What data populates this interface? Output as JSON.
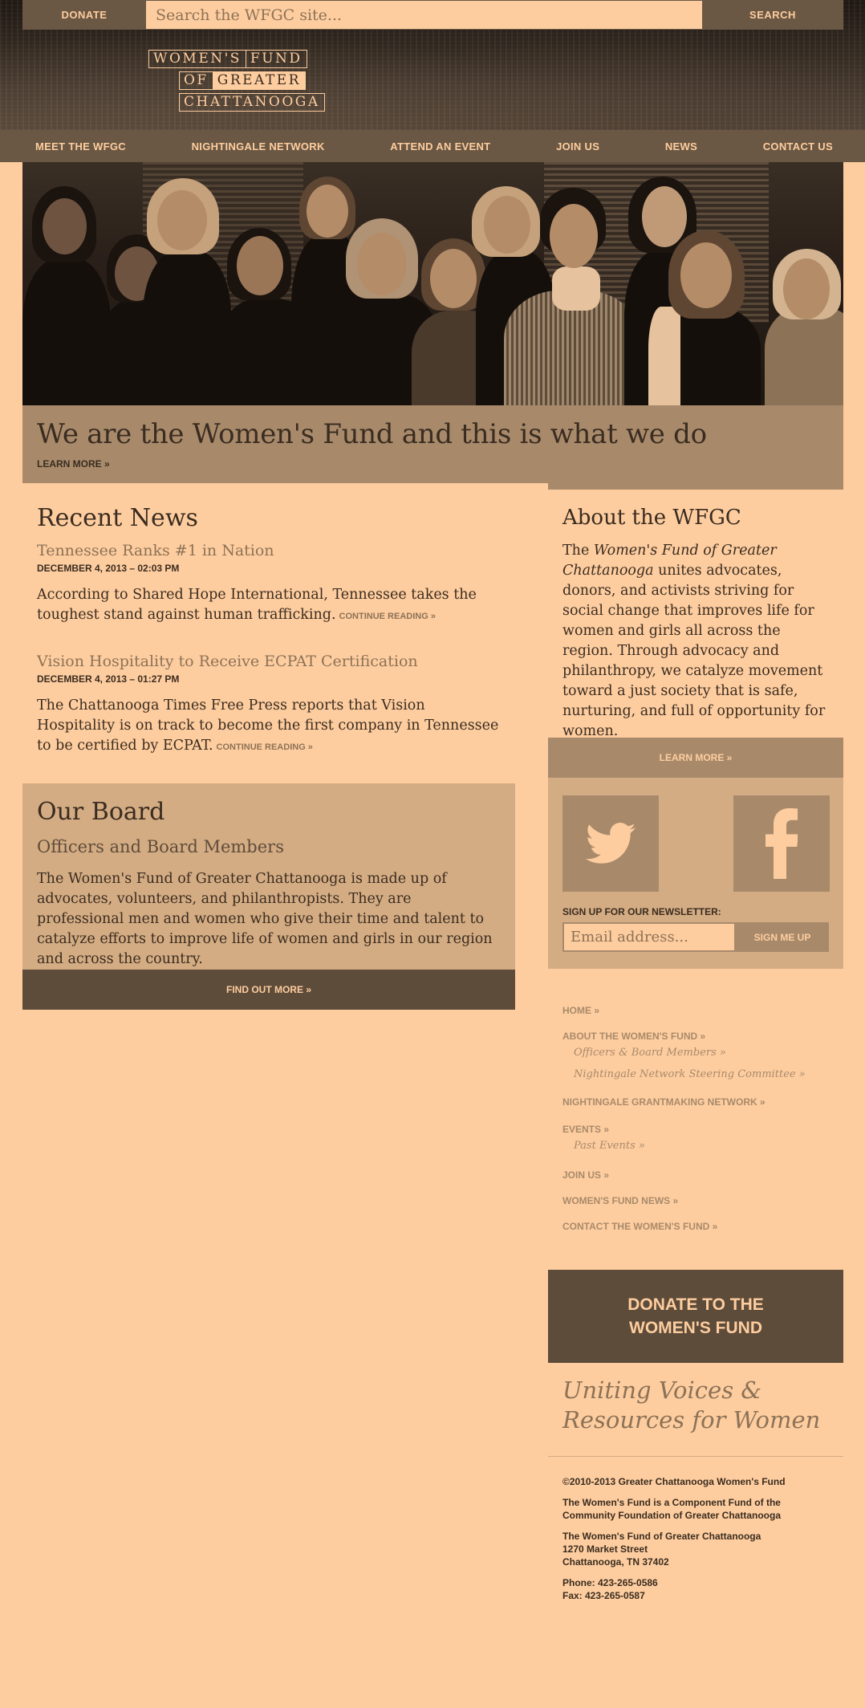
{
  "topbar": {
    "donate_label": "DONATE",
    "search_placeholder": "Search the WFGC site...",
    "search_label": "SEARCH"
  },
  "logo": {
    "line1a": "WOMEN'S",
    "line1b": "FUND",
    "line2a": "OF",
    "line2b": "GREATER",
    "line3": "CHATTANOOGA"
  },
  "nav": {
    "items": [
      "MEET THE WFGC",
      "NIGHTINGALE NETWORK",
      "ATTEND AN EVENT",
      "JOIN US",
      "NEWS",
      "CONTACT US"
    ]
  },
  "hero": {
    "headline": "We are the Women's Fund and this is what we do",
    "learn_more": "LEARN MORE  »"
  },
  "news": {
    "heading": "Recent News",
    "items": [
      {
        "title": "Tennessee Ranks #1 in Nation",
        "date": "DECEMBER 4, 2013 – 02:03 PM",
        "body": "According to Shared Hope International, Tennessee takes the toughest stand against human trafficking.",
        "continue": "CONTINUE READING »"
      },
      {
        "title": "Vision Hospitality to Receive ECPAT Certification",
        "date": "DECEMBER 4, 2013 – 01:27 PM",
        "body": "The Chattanooga Times Free Press reports that Vision Hospitality is on track to become the first company in Tennessee to be certified by ECPAT.",
        "continue": "CONTINUE READING »"
      }
    ]
  },
  "board": {
    "heading": "Our Board",
    "subheading": "Officers and Board Members",
    "body": "The Women's Fund of Greater Chattanooga is made up of advocates, volunteers, and philanthropists. They are professional men and women who give their time and talent to catalyze efforts to improve life of women and girls in our region and across the country.",
    "button": "FIND OUT MORE »"
  },
  "about": {
    "heading": "About the WFGC",
    "body_prefix": "The ",
    "body_em": "Women's Fund of Greater Chattanooga",
    "body_rest": " unites advocates, donors, and activists striving for social change that improves life for women and girls all across the region. Through advocacy and philanthropy, we catalyze movement toward a just society that is safe, nurturing, and full of opportunity for women.",
    "button": "LEARN MORE »"
  },
  "newsletter": {
    "label": "SIGN UP FOR OUR NEWSLETTER:",
    "placeholder": "Email address...",
    "button": "SIGN ME UP"
  },
  "sitemap": {
    "home": "HOME »",
    "about": "ABOUT THE WOMEN'S FUND »",
    "officers": "Officers & Board Members »",
    "nightingale_committee": "Nightingale Network Steering Committee »",
    "nightingale": "NIGHTINGALE GRANTMAKING NETWORK »",
    "events": "EVENTS »",
    "past_events": "Past Events »",
    "join": "JOIN US »",
    "news": "WOMEN'S FUND NEWS »",
    "contact": "CONTACT THE WOMEN'S FUND »"
  },
  "donate_big": {
    "line1": "DONATE TO THE",
    "line2": "WOMEN'S FUND"
  },
  "tagline": "Uniting Voices & Resources for Women",
  "footer": {
    "copyright": "©2010-2013 Greater Chattanooga Women's Fund",
    "component1": "The Women's Fund is a Component Fund of the",
    "component2": "Community Foundation of Greater Chattanooga",
    "org": "The Women's Fund of Greater Chattanooga",
    "street": "1270 Market Street",
    "city": "Chattanooga, TN 37402",
    "phone": "Phone: 423-265-0586",
    "fax": "Fax: 423-265-0587"
  },
  "colors": {
    "page_bg": "#FECD9F",
    "dark_brown": "#5e4c3b",
    "mid_brown": "#a88a6b",
    "tan": "#d4ac83",
    "text": "#3a2c20"
  }
}
